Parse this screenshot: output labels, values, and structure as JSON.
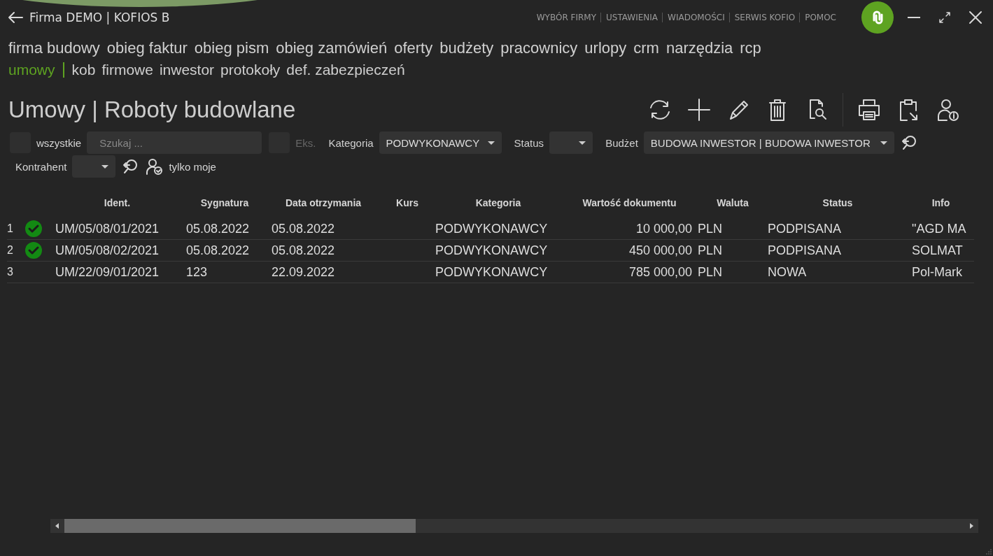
{
  "window": {
    "title": "Firma DEMO | KOFIOS B"
  },
  "top_links": [
    "WYBÓR FIRMY",
    "USTAWIENIA",
    "WIADOMOŚCI",
    "SERWIS KOFIO",
    "POMOC"
  ],
  "modules": [
    "firma budowy",
    "obieg faktur",
    "obieg pism",
    "obieg zamówień",
    "oferty",
    "budżety",
    "pracownicy",
    "urlopy",
    "crm",
    "narzędzia",
    "rcp"
  ],
  "submodules": [
    {
      "label": "umowy",
      "selected": true
    },
    {
      "label": "kob",
      "selected": false
    },
    {
      "label": "firmowe",
      "selected": false
    },
    {
      "label": "inwestor",
      "selected": false
    },
    {
      "label": "protokoły",
      "selected": false
    },
    {
      "label": "def. zabezpieczeń",
      "selected": false
    }
  ],
  "page_title": "Umowy | Roboty budowlane",
  "filters": {
    "all": {
      "label": "wszystkie",
      "checked": false
    },
    "search": {
      "placeholder": "Szukaj ..."
    },
    "eks": {
      "label": "Eks.",
      "checked": false,
      "disabled": true
    },
    "kategoria": {
      "label": "Kategoria",
      "value": "PODWYKONAWCY"
    },
    "status": {
      "label": "Status"
    },
    "budzet": {
      "label": "Budżet",
      "value": "BUDOWA INWESTOR | BUDOWA INWESTOR"
    },
    "kontrahent": {
      "label": "Kontrahent"
    },
    "mine": {
      "label": "tylko moje"
    }
  },
  "table": {
    "columns": [
      "Ident.",
      "Sygnatura",
      "Data otrzymania",
      "Kurs",
      "Kategoria",
      "Wartość dokumentu",
      "Waluta",
      "Status",
      "Info"
    ],
    "rows": [
      {
        "number": "1",
        "approved": true,
        "cells": [
          "UM/05/08/01/2021",
          "05.08.2022",
          "05.08.2022",
          "",
          "PODWYKONAWCY",
          "10 000,00",
          "PLN",
          "PODPISANA",
          "\"AGD MA"
        ]
      },
      {
        "number": "2",
        "approved": true,
        "cells": [
          "UM/05/08/02/2021",
          "05.08.2022",
          "05.08.2022",
          "",
          "PODWYKONAWCY",
          "450 000,00",
          "PLN",
          "PODPISANA",
          "SOLMAT"
        ]
      },
      {
        "number": "3",
        "approved": false,
        "cells": [
          "UM/22/09/01/2021",
          "123",
          "22.09.2022",
          "",
          "PODWYKONAWCY",
          "785 000,00",
          "PLN",
          "NOWA",
          "Pol-Mark"
        ]
      }
    ]
  }
}
